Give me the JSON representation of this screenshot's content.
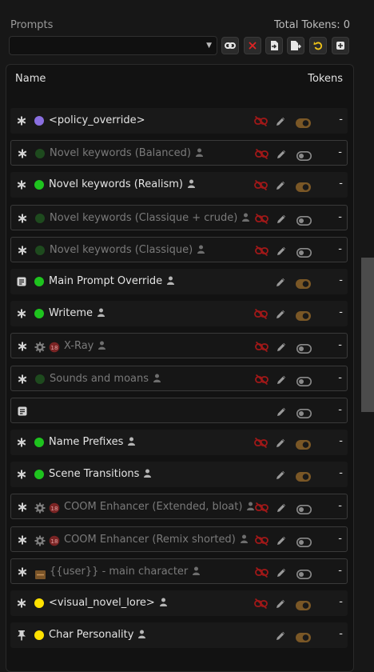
{
  "header": {
    "title": "Prompts",
    "total_tokens": "Total Tokens: 0"
  },
  "toolbar": {
    "select_value": "",
    "buttons": [
      "link-icon",
      "delete-icon",
      "import-icon",
      "export-icon",
      "reset-icon",
      "add-icon"
    ]
  },
  "columns": {
    "name": "Name",
    "tokens": "Tokens"
  },
  "colors": {
    "purple": "#8a6fe0",
    "green": "#1ec31e",
    "dark_green": "#1e4a1e",
    "yellow": "#ffe100",
    "toggle_on": "#7a5726",
    "red": "#a01818"
  },
  "prompts": [
    {
      "name": "<policy_override>",
      "enabled": true,
      "icon": "asterisk",
      "marker": "dot",
      "dot": "purple",
      "user": false,
      "unlink": true,
      "toggle": true,
      "tokens": "-"
    },
    {
      "name": "Novel keywords (Balanced)",
      "enabled": false,
      "icon": "asterisk",
      "marker": "dot",
      "dot": "dark_green",
      "user": true,
      "unlink": true,
      "toggle": false,
      "tokens": "-"
    },
    {
      "name": "Novel keywords (Realism)",
      "enabled": true,
      "icon": "asterisk",
      "marker": "dot",
      "dot": "green",
      "user": true,
      "unlink": true,
      "toggle": true,
      "tokens": "-"
    },
    {
      "name": "Novel keywords (Classique + crude)",
      "enabled": false,
      "icon": "asterisk",
      "marker": "dot",
      "dot": "dark_green",
      "user": true,
      "unlink": true,
      "toggle": false,
      "tokens": "-"
    },
    {
      "name": "Novel keywords (Classique)",
      "enabled": false,
      "icon": "asterisk",
      "marker": "dot",
      "dot": "dark_green",
      "user": true,
      "unlink": true,
      "toggle": false,
      "tokens": "-"
    },
    {
      "name": "Main Prompt Override",
      "enabled": true,
      "icon": "note",
      "marker": "dot",
      "dot": "green",
      "user": true,
      "unlink": false,
      "toggle": true,
      "tokens": "-"
    },
    {
      "name": "Writeme",
      "enabled": true,
      "icon": "asterisk",
      "marker": "dot",
      "dot": "green",
      "user": true,
      "unlink": true,
      "toggle": true,
      "tokens": "-"
    },
    {
      "name": "X-Ray",
      "enabled": false,
      "icon": "asterisk",
      "marker": "gear18",
      "user": true,
      "unlink": true,
      "toggle": false,
      "tokens": "-"
    },
    {
      "name": "Sounds and moans",
      "enabled": false,
      "icon": "asterisk",
      "marker": "dot",
      "dot": "dark_green",
      "user": true,
      "unlink": true,
      "toggle": false,
      "tokens": "-"
    },
    {
      "name": "",
      "enabled": false,
      "icon": "note",
      "marker": "none",
      "user": false,
      "unlink": false,
      "toggle": false,
      "tokens": "-"
    },
    {
      "name": "Name Prefixes",
      "enabled": true,
      "icon": "asterisk",
      "marker": "dot",
      "dot": "green",
      "user": true,
      "unlink": true,
      "toggle": true,
      "tokens": "-"
    },
    {
      "name": "Scene Transitions",
      "enabled": true,
      "icon": "asterisk",
      "marker": "dot",
      "dot": "green",
      "user": true,
      "unlink": false,
      "toggle": true,
      "tokens": "-"
    },
    {
      "name": "COOM Enhancer (Extended, bloat)",
      "enabled": false,
      "icon": "asterisk",
      "marker": "gear18",
      "user": true,
      "unlink": true,
      "toggle": false,
      "tokens": "-"
    },
    {
      "name": "COOM Enhancer (Remix shorted)",
      "enabled": false,
      "icon": "asterisk",
      "marker": "gear18",
      "user": true,
      "unlink": true,
      "toggle": false,
      "tokens": "-"
    },
    {
      "name": "{{user}} - main character",
      "enabled": false,
      "icon": "asterisk",
      "marker": "box",
      "user": true,
      "unlink": true,
      "toggle": false,
      "tokens": "-"
    },
    {
      "name": "<visual_novel_lore>",
      "enabled": true,
      "icon": "asterisk",
      "marker": "dot",
      "dot": "yellow",
      "user": true,
      "unlink": true,
      "toggle": true,
      "tokens": "-"
    },
    {
      "name": "Char Personality",
      "enabled": true,
      "icon": "pin",
      "marker": "dot",
      "dot": "yellow",
      "user": true,
      "unlink": false,
      "toggle": true,
      "tokens": "-"
    }
  ]
}
